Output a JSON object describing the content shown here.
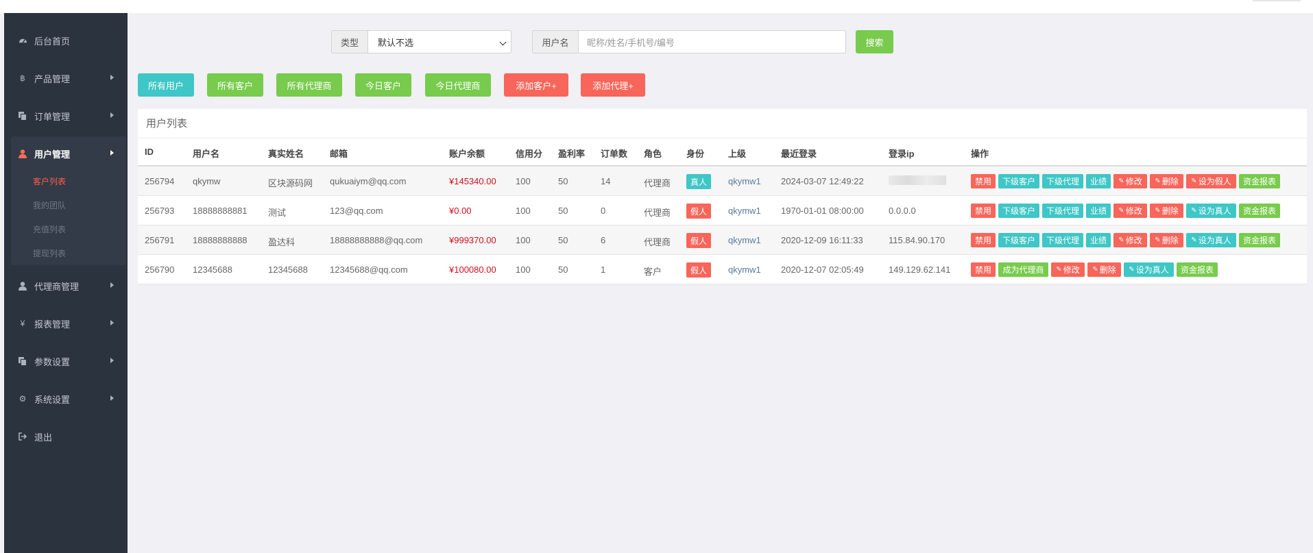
{
  "sidebar": {
    "items": [
      {
        "label": "后台首页",
        "icon": "dashboard-icon"
      },
      {
        "label": "产品管理",
        "icon": "bitcoin-icon"
      },
      {
        "label": "订单管理",
        "icon": "copy-icon"
      },
      {
        "label": "用户管理",
        "icon": "user-icon"
      },
      {
        "label": "代理商管理",
        "icon": "user-icon"
      },
      {
        "label": "报表管理",
        "icon": "yen-icon"
      },
      {
        "label": "参数设置",
        "icon": "copy-icon"
      },
      {
        "label": "系统设置",
        "icon": "gears-icon"
      },
      {
        "label": "退出",
        "icon": "sign-out-icon"
      }
    ],
    "sub_items": [
      "客户列表",
      "我的团队",
      "充值列表",
      "提现列表"
    ]
  },
  "search": {
    "type_label": "类型",
    "type_value": "默认不选",
    "user_label": "用户名",
    "user_placeholder": "昵称/姓名/手机号/编号",
    "search_button": "搜索"
  },
  "toolbar": {
    "all_users": "所有用户",
    "all_customers": "所有客户",
    "all_agents": "所有代理商",
    "today_customers": "今日客户",
    "today_agents": "今日代理商",
    "add_customer": "添加客户+",
    "add_agent": "添加代理+"
  },
  "panel": {
    "title": "用户列表"
  },
  "table": {
    "headers": [
      "ID",
      "用户名",
      "真实姓名",
      "邮箱",
      "账户余额",
      "信用分",
      "盈利率",
      "订单数",
      "角色",
      "身份",
      "上级",
      "最近登录",
      "登录ip",
      "操作"
    ],
    "rows": [
      {
        "id": "256794",
        "username": "qkymw",
        "realname": "区块源码网",
        "email": "qukuaiym@qq.com",
        "balance": "¥145340.00",
        "credit": "100",
        "profit": "50",
        "orders": "14",
        "role": "代理商",
        "identity": "真人",
        "parent": "qkymw1",
        "last_login": "2024-03-07 12:49:22",
        "ip": ""
      },
      {
        "id": "256793",
        "username": "18888888881",
        "realname": "测试",
        "email": "123@qq.com",
        "balance": "¥0.00",
        "credit": "100",
        "profit": "50",
        "orders": "0",
        "role": "代理商",
        "identity": "假人",
        "parent": "qkymw1",
        "last_login": "1970-01-01 08:00:00",
        "ip": "0.0.0.0"
      },
      {
        "id": "256791",
        "username": "18888888888",
        "realname": "盈达科",
        "email": "18888888888@qq.com",
        "balance": "¥999370.00",
        "credit": "100",
        "profit": "50",
        "orders": "6",
        "role": "代理商",
        "identity": "假人",
        "parent": "qkymw1",
        "last_login": "2020-12-09 16:11:33",
        "ip": "115.84.90.170"
      },
      {
        "id": "256790",
        "username": "12345688",
        "realname": "12345688",
        "email": "12345688@qq.com",
        "balance": "¥100080.00",
        "credit": "100",
        "profit": "50",
        "orders": "1",
        "role": "客户",
        "identity": "假人",
        "parent": "qkymw1",
        "last_login": "2020-12-07 02:05:49",
        "ip": "149.129.62.141"
      }
    ]
  },
  "ops": {
    "disable": "禁用",
    "sub_customers": "下级客户",
    "sub_agents": "下级代理",
    "performance": "业绩",
    "edit": "修改",
    "delete": "删除",
    "set_fake": "设为假人",
    "set_real": "设为真人",
    "fund_report": "资金报表",
    "become_agent": "成为代理商"
  },
  "colors": {
    "sidebar_bg": "#2b333e",
    "teal": "#3fc6c6",
    "green": "#78cb4d",
    "red": "#f8655a",
    "money": "#d00f1d",
    "active_sub": "#ff5b4e"
  }
}
